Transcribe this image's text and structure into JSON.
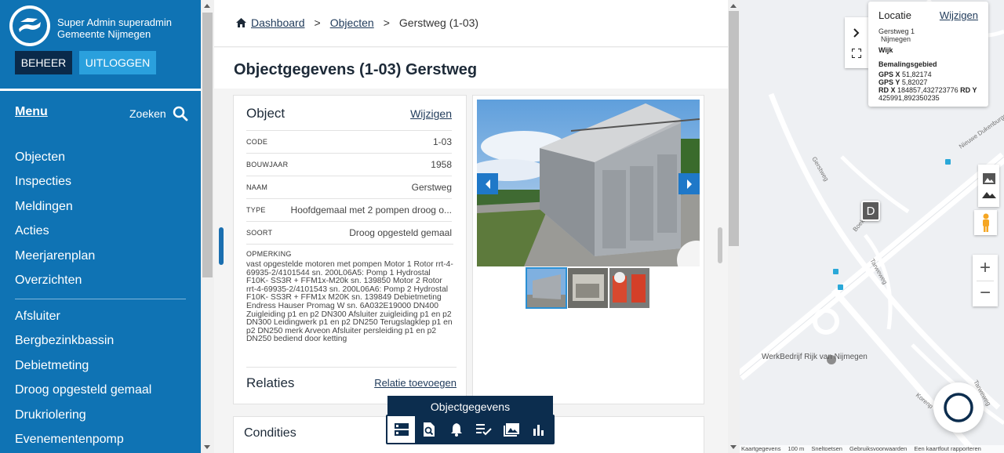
{
  "sidebar": {
    "user_line1": "Super Admin superadmin",
    "user_line2": "Gemeente Nijmegen",
    "btn_beheer": "BEHEER",
    "btn_uitloggen": "UITLOGGEN",
    "menu_label": "Menu",
    "search_label": "Zoeken",
    "items_primary": [
      "Objecten",
      "Inspecties",
      "Meldingen",
      "Acties",
      "Meerjarenplan",
      "Overzichten"
    ],
    "items_secondary": [
      "Afsluiter",
      "Bergbezinkbassin",
      "Debietmeting",
      "Droog opgesteld gemaal",
      "Drukriolering",
      "Evenementenpomp"
    ]
  },
  "breadcrumb": {
    "dashboard": "Dashboard",
    "objecten": "Objecten",
    "current": "Gerstweg (1-03)",
    "sep": ">"
  },
  "page_title": "Objectgegevens (1-03) Gerstweg",
  "object_card": {
    "title": "Object",
    "edit": "Wijzigen",
    "rows": [
      {
        "key": "CODE",
        "value": "1-03"
      },
      {
        "key": "BOUWJAAR",
        "value": "1958"
      },
      {
        "key": "NAAM",
        "value": "Gerstweg"
      },
      {
        "key": "TYPE",
        "value": "Hoofdgemaal met 2 pompen droog o..."
      },
      {
        "key": "SOORT",
        "value": "Droog opgesteld gemaal"
      }
    ],
    "opmerking_label": "OPMERKING",
    "opmerking": "vast opgestelde motoren met pompen Motor 1 Rotor rrt-4-69935-2/4101544 sn. 200L06A5: Pomp 1 Hydrostal F10K- SS3R + FFM1x-M20k sn. 139850 Motor 2 Rotor rrt-4-69935-2/4101543 sn. 200L06A6: Pomp 2 Hydrostal F10K- SS3R + FFM1x M20K sn. 139849 Debietmeting Endress Hauser Promag W sn. 6A032E19000 DN400 Zuigleiding p1 en p2 DN300 Afsluiter zuigleiding p1 en p2 DN300 Leidingwerk p1 en p2 DN250 Terugslagklep p1 en p2 DN250 merk Arveon Afsluiter persleiding p1 en p2 DN250 bediend door ketting",
    "relaties_title": "Relaties",
    "relaties_link": "Relatie toevoegen"
  },
  "condities_title": "Condities",
  "toolbar": {
    "label": "Objectgegevens",
    "buttons": [
      "objectgegevens-icon",
      "inspecties-icon",
      "meldingen-icon",
      "acties-icon",
      "fotos-icon",
      "overzichten-icon"
    ]
  },
  "location": {
    "title": "Locatie",
    "edit": "Wijzigen",
    "address1": "Gerstweg 1",
    "address2": "Nijmegen",
    "wijk_label": "Wijk",
    "bemaling_label": "Bemalingsgebied",
    "gps_x_label": "GPS X",
    "gps_x": "51,82174",
    "gps_y_label": "GPS Y",
    "gps_y": "5,82027",
    "rd_x_label": "RD X",
    "rd_x": "184857,432723776",
    "rd_y_label": "RD Y",
    "rd_y": "425991,892350235"
  },
  "map": {
    "marker_letter": "D",
    "poi_name": "WerkBedrijf Rijk van Nijmegen",
    "streets": [
      "Nieuwe Dukenburgseweg",
      "Gerstweg",
      "Boekweitweg",
      "Tarweweg",
      "Tarweweg",
      "Korenp"
    ],
    "footer": [
      "Kaartgegevens",
      "100 m",
      "Sneltoetsen",
      "Gebruiksvoorwaarden",
      "Een kaartfout rapporteren"
    ],
    "zoom_in": "+",
    "zoom_out": "−"
  },
  "colors": {
    "sidebar": "#0f73b4",
    "navy": "#0c2d4e",
    "accent": "#2aa0dd"
  }
}
